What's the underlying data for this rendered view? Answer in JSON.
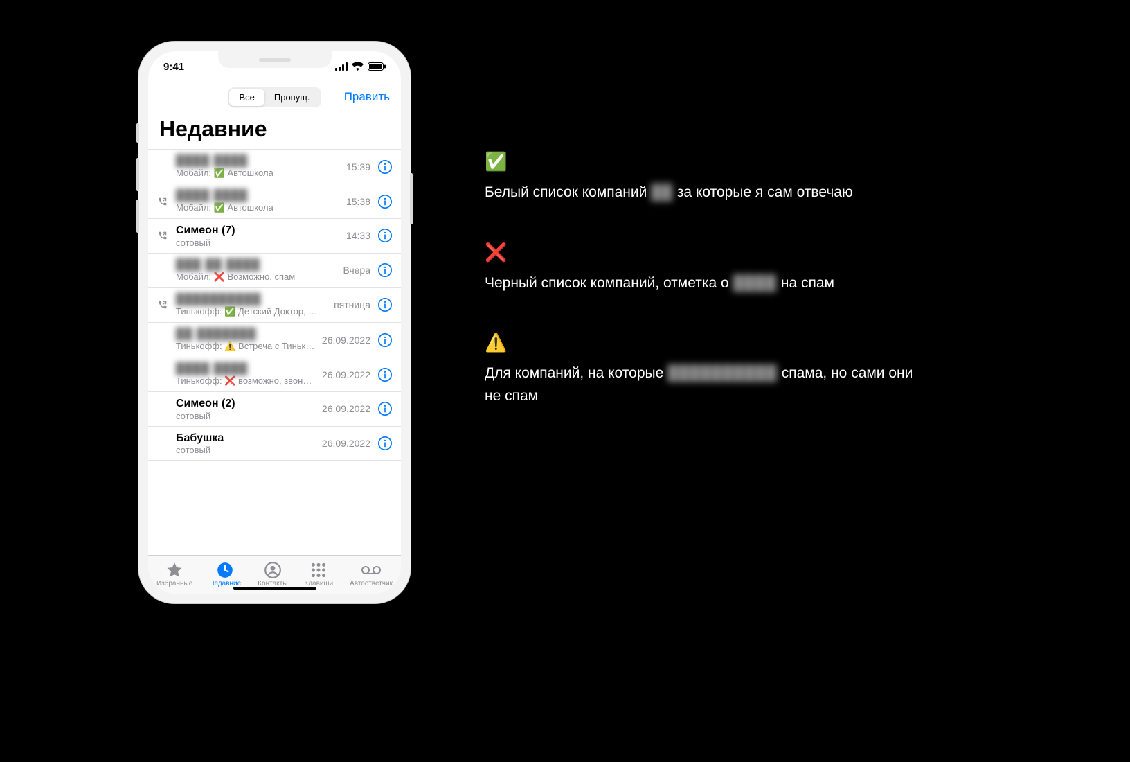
{
  "statusbar": {
    "time": "9:41"
  },
  "topnav": {
    "seg_all": "Все",
    "seg_missed": "Пропущ.",
    "edit": "Править"
  },
  "title": "Недавние",
  "rows": [
    {
      "name_blur": "████ ████",
      "out": false,
      "sub_prefix": "Мобайл: ",
      "sub_emoji": "✅",
      "sub_rest": " Автошкола",
      "time": "15:39"
    },
    {
      "name_blur": "████ ████",
      "out": true,
      "sub_prefix": "Мобайл: ",
      "sub_emoji": "✅",
      "sub_rest": " Автошкола",
      "time": "15:38"
    },
    {
      "name_plain": "Симеон (7)",
      "out": true,
      "sub_plain": "сотовый",
      "time": "14:33"
    },
    {
      "name_blur": "███ ██ ████",
      "out": false,
      "sub_prefix": "Мобайл: ",
      "sub_emoji": "❌",
      "sub_rest": " Возможно, спам",
      "time": "Вчера"
    },
    {
      "name_blur": "██████████",
      "out": true,
      "sub_prefix": "Тинькофф: ",
      "sub_emoji": "✅",
      "sub_rest": " Детский Доктор, Мед…",
      "time": "пятница"
    },
    {
      "name_blur": "██ ███████",
      "out": false,
      "sub_prefix": "Тинькофф: ",
      "sub_emoji": "⚠️",
      "sub_rest": " Встреча с Тинько…",
      "time": "26.09.2022"
    },
    {
      "name_blur": "████ ████",
      "out": false,
      "sub_prefix": "Тинькофф: ",
      "sub_emoji": "❌",
      "sub_rest": " возможно, звонят…",
      "time": "26.09.2022"
    },
    {
      "name_plain": "Симеон (2)",
      "out": false,
      "sub_plain": "сотовый",
      "time": "26.09.2022"
    },
    {
      "name_plain": "Бабушка",
      "out": false,
      "sub_plain": "сотовый",
      "time": "26.09.2022"
    }
  ],
  "tabs": {
    "favorites": "Избранные",
    "recents": "Недавние",
    "contacts": "Контакты",
    "keypad": "Клавиши",
    "voicemail": "Автоответчик"
  },
  "legend": {
    "ok": {
      "emoji": "✅",
      "text_pre": "Белый список компаний ",
      "text_blur": "██",
      "text_post": " за которые я сам отвечаю"
    },
    "bad": {
      "emoji": "❌",
      "text_pre": "Черный список компаний, отметка о ",
      "text_blur": "████",
      "text_post": " на спам"
    },
    "warn": {
      "emoji": "⚠️",
      "text_pre": "Для компаний, на которые ",
      "text_blur": "██████████",
      "text_post": " спама, но сами они не спам"
    }
  }
}
